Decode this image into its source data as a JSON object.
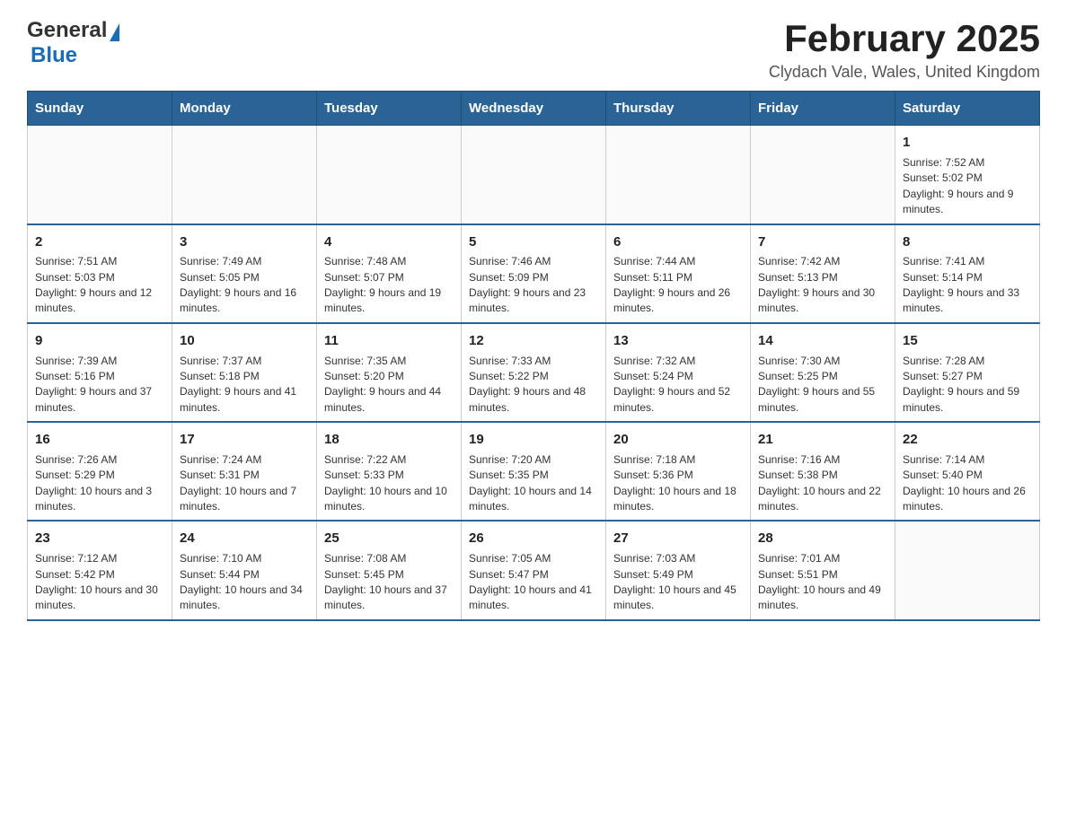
{
  "header": {
    "logo_general": "General",
    "logo_blue": "Blue",
    "month_title": "February 2025",
    "location": "Clydach Vale, Wales, United Kingdom"
  },
  "days_of_week": [
    "Sunday",
    "Monday",
    "Tuesday",
    "Wednesday",
    "Thursday",
    "Friday",
    "Saturday"
  ],
  "weeks": [
    [
      {
        "day": "",
        "info": ""
      },
      {
        "day": "",
        "info": ""
      },
      {
        "day": "",
        "info": ""
      },
      {
        "day": "",
        "info": ""
      },
      {
        "day": "",
        "info": ""
      },
      {
        "day": "",
        "info": ""
      },
      {
        "day": "1",
        "info": "Sunrise: 7:52 AM\nSunset: 5:02 PM\nDaylight: 9 hours and 9 minutes."
      }
    ],
    [
      {
        "day": "2",
        "info": "Sunrise: 7:51 AM\nSunset: 5:03 PM\nDaylight: 9 hours and 12 minutes."
      },
      {
        "day": "3",
        "info": "Sunrise: 7:49 AM\nSunset: 5:05 PM\nDaylight: 9 hours and 16 minutes."
      },
      {
        "day": "4",
        "info": "Sunrise: 7:48 AM\nSunset: 5:07 PM\nDaylight: 9 hours and 19 minutes."
      },
      {
        "day": "5",
        "info": "Sunrise: 7:46 AM\nSunset: 5:09 PM\nDaylight: 9 hours and 23 minutes."
      },
      {
        "day": "6",
        "info": "Sunrise: 7:44 AM\nSunset: 5:11 PM\nDaylight: 9 hours and 26 minutes."
      },
      {
        "day": "7",
        "info": "Sunrise: 7:42 AM\nSunset: 5:13 PM\nDaylight: 9 hours and 30 minutes."
      },
      {
        "day": "8",
        "info": "Sunrise: 7:41 AM\nSunset: 5:14 PM\nDaylight: 9 hours and 33 minutes."
      }
    ],
    [
      {
        "day": "9",
        "info": "Sunrise: 7:39 AM\nSunset: 5:16 PM\nDaylight: 9 hours and 37 minutes."
      },
      {
        "day": "10",
        "info": "Sunrise: 7:37 AM\nSunset: 5:18 PM\nDaylight: 9 hours and 41 minutes."
      },
      {
        "day": "11",
        "info": "Sunrise: 7:35 AM\nSunset: 5:20 PM\nDaylight: 9 hours and 44 minutes."
      },
      {
        "day": "12",
        "info": "Sunrise: 7:33 AM\nSunset: 5:22 PM\nDaylight: 9 hours and 48 minutes."
      },
      {
        "day": "13",
        "info": "Sunrise: 7:32 AM\nSunset: 5:24 PM\nDaylight: 9 hours and 52 minutes."
      },
      {
        "day": "14",
        "info": "Sunrise: 7:30 AM\nSunset: 5:25 PM\nDaylight: 9 hours and 55 minutes."
      },
      {
        "day": "15",
        "info": "Sunrise: 7:28 AM\nSunset: 5:27 PM\nDaylight: 9 hours and 59 minutes."
      }
    ],
    [
      {
        "day": "16",
        "info": "Sunrise: 7:26 AM\nSunset: 5:29 PM\nDaylight: 10 hours and 3 minutes."
      },
      {
        "day": "17",
        "info": "Sunrise: 7:24 AM\nSunset: 5:31 PM\nDaylight: 10 hours and 7 minutes."
      },
      {
        "day": "18",
        "info": "Sunrise: 7:22 AM\nSunset: 5:33 PM\nDaylight: 10 hours and 10 minutes."
      },
      {
        "day": "19",
        "info": "Sunrise: 7:20 AM\nSunset: 5:35 PM\nDaylight: 10 hours and 14 minutes."
      },
      {
        "day": "20",
        "info": "Sunrise: 7:18 AM\nSunset: 5:36 PM\nDaylight: 10 hours and 18 minutes."
      },
      {
        "day": "21",
        "info": "Sunrise: 7:16 AM\nSunset: 5:38 PM\nDaylight: 10 hours and 22 minutes."
      },
      {
        "day": "22",
        "info": "Sunrise: 7:14 AM\nSunset: 5:40 PM\nDaylight: 10 hours and 26 minutes."
      }
    ],
    [
      {
        "day": "23",
        "info": "Sunrise: 7:12 AM\nSunset: 5:42 PM\nDaylight: 10 hours and 30 minutes."
      },
      {
        "day": "24",
        "info": "Sunrise: 7:10 AM\nSunset: 5:44 PM\nDaylight: 10 hours and 34 minutes."
      },
      {
        "day": "25",
        "info": "Sunrise: 7:08 AM\nSunset: 5:45 PM\nDaylight: 10 hours and 37 minutes."
      },
      {
        "day": "26",
        "info": "Sunrise: 7:05 AM\nSunset: 5:47 PM\nDaylight: 10 hours and 41 minutes."
      },
      {
        "day": "27",
        "info": "Sunrise: 7:03 AM\nSunset: 5:49 PM\nDaylight: 10 hours and 45 minutes."
      },
      {
        "day": "28",
        "info": "Sunrise: 7:01 AM\nSunset: 5:51 PM\nDaylight: 10 hours and 49 minutes."
      },
      {
        "day": "",
        "info": ""
      }
    ]
  ]
}
